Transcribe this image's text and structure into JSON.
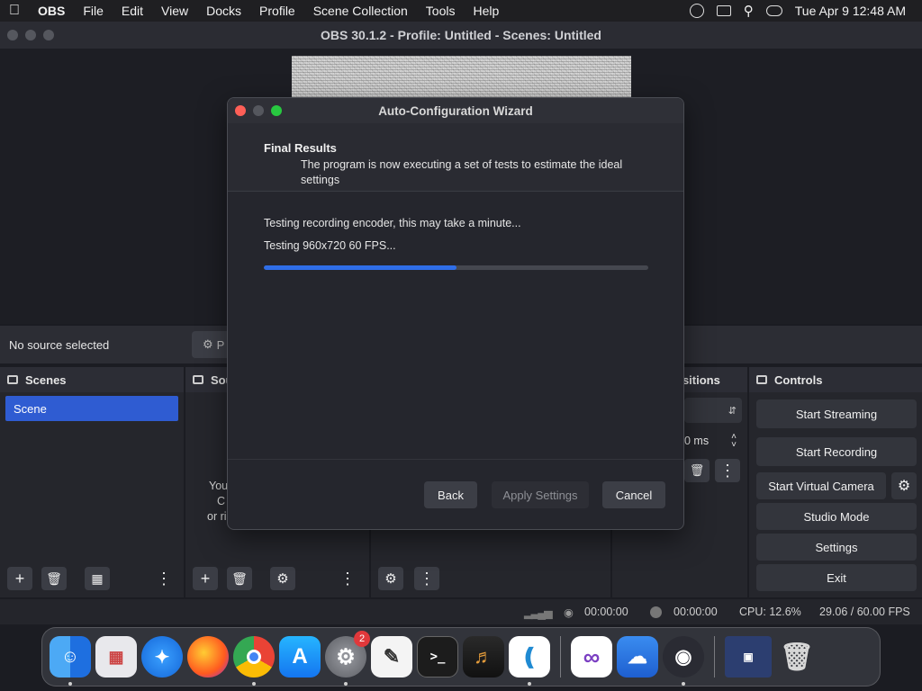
{
  "menubar": {
    "app_name": "OBS",
    "items": [
      "File",
      "Edit",
      "View",
      "Docks",
      "Profile",
      "Scene Collection",
      "Tools",
      "Help"
    ],
    "clock": "Tue Apr 9  12:48 AM"
  },
  "window": {
    "title": "OBS 30.1.2 - Profile: Untitled - Scenes: Untitled"
  },
  "source_bar": {
    "no_source": "No source selected",
    "properties_label": "P"
  },
  "docks": {
    "scenes": {
      "title": "Scenes",
      "items": [
        "Scene"
      ]
    },
    "sources": {
      "title": "Sou",
      "empty_lines": [
        "You",
        "C",
        "or ri"
      ]
    },
    "transitions": {
      "title": "nsitions",
      "duration": "0 ms"
    },
    "controls": {
      "title": "Controls",
      "start_streaming": "Start Streaming",
      "start_recording": "Start Recording",
      "start_virtual_camera": "Start Virtual Camera",
      "studio_mode": "Studio Mode",
      "settings": "Settings",
      "exit": "Exit"
    }
  },
  "statusbar": {
    "stream_time": "00:00:00",
    "record_time": "00:00:00",
    "cpu": "CPU: 12.6%",
    "fps": "29.06 / 60.00 FPS"
  },
  "wizard": {
    "title": "Auto-Configuration Wizard",
    "heading": "Final Results",
    "description": "The program is now executing a set of tests to estimate the ideal settings",
    "line1": "Testing recording encoder, this may take a minute...",
    "line2": "Testing 960x720 60 FPS...",
    "progress": 0.5,
    "back": "Back",
    "apply": "Apply Settings",
    "cancel": "Cancel"
  },
  "dock_apps": {
    "settings_badge": "2",
    "names": [
      "finder-icon",
      "launchpad-icon",
      "safari-icon",
      "firefox-icon",
      "chrome-icon",
      "app-store-icon",
      "system-settings-icon",
      "textedit-icon",
      "terminal-icon",
      "garageband-icon",
      "vscode-icon",
      "visual-studio-icon",
      "weather-icon",
      "obs-icon",
      "window-preview-icon",
      "trash-icon"
    ]
  },
  "colors": {
    "accent_blue": "#2f5cd2",
    "progress_blue": "#2f6ee8",
    "close_red": "#fe5f57",
    "min_yellow": "#febc2e",
    "max_green": "#28c840"
  }
}
